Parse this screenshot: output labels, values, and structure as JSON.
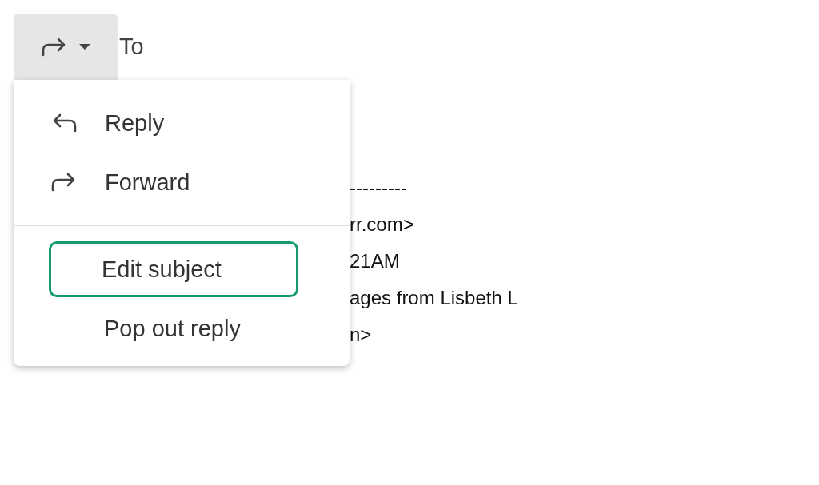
{
  "compose": {
    "reply_type_button": {
      "kind": "forward"
    },
    "to_label": "To"
  },
  "menu": {
    "items": [
      {
        "kind": "reply",
        "label": "Reply",
        "selected": false
      },
      {
        "kind": "forward",
        "label": "Forward",
        "selected": false
      },
      {
        "kind": "divider"
      },
      {
        "kind": "action",
        "label": "Edit subject",
        "selected": true
      },
      {
        "kind": "action",
        "label": "Pop out reply",
        "selected": false
      }
    ]
  },
  "quoted_message": {
    "lines": [
      "---------",
      "rr.com>",
      "21AM",
      "ages from Lisbeth L",
      "n>"
    ]
  }
}
